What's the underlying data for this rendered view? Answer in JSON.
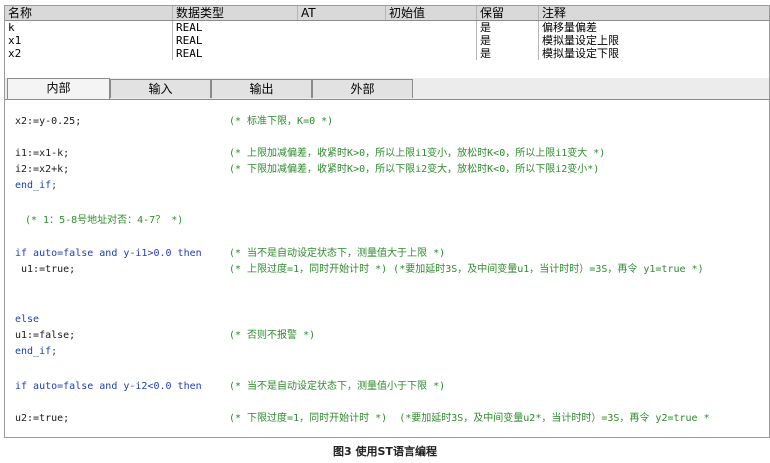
{
  "table": {
    "headers": [
      "名称",
      "数据类型",
      "AT",
      "初始值",
      "保留",
      "注释"
    ],
    "rows": [
      {
        "name": "k",
        "type": "REAL",
        "at": "",
        "init": "",
        "retain": "是",
        "comment": "偏移量偏差"
      },
      {
        "name": "x1",
        "type": "REAL",
        "at": "",
        "init": "",
        "retain": "是",
        "comment": "模拟量设定上限"
      },
      {
        "name": "x2",
        "type": "REAL",
        "at": "",
        "init": "",
        "retain": "是",
        "comment": "模拟量设定下限"
      }
    ]
  },
  "tabs": [
    "内部",
    "输入",
    "输出",
    "外部"
  ],
  "code_lines": [
    {
      "code": "x2:=y-0.25;",
      "comment": "(* 标准下限，K=0 *)"
    },
    {
      "code": "i1:=x1-k;",
      "comment": "(* 上限加减偏差，收紧时K>0，所以上限i1变小，放松时K<0，所以上限i1变大 *)"
    },
    {
      "code": "i2:=x2+k;",
      "comment": "(* 下限加减偏差，收紧时K>0，所以下限i2变大，放松时K<0，所以下限i2变小*)"
    },
    {
      "code": "end_if;",
      "comment": ""
    },
    {
      "code": "",
      "comment": "(* 1：5-8号地址对否：4-7？ *)"
    },
    {
      "code": "if auto=false and y-i1>0.0 then",
      "comment": "(* 当不是自动设定状态下，测量值大于上限 *)"
    },
    {
      "code": " u1:=true;",
      "comment": "(* 上限过度=1，同时开始计时 *) (*要加延时3S，及中间变量u1，当计时时）=3S，再令 y1=true *)"
    },
    {
      "code": "else",
      "comment": ""
    },
    {
      "code": "u1:=false;",
      "comment": "(* 否则不报警 *)"
    },
    {
      "code": "end_if;",
      "comment": ""
    },
    {
      "code": "if auto=false and y-i2<0.0 then",
      "comment": "(* 当不是自动设定状态下，测量值小于下限 *)"
    },
    {
      "code": "u2:=true;",
      "comment": "(* 下限过度=1，同时开始计时 *)  (*要加延时3S，及中间变量u2*，当计时时）=3S，再令 y2=true *"
    }
  ],
  "caption": "图3  使用ST语言编程",
  "colors": {
    "keyword": "#1f3fb0",
    "comment": "#2e8b2e",
    "header_bg": "#d9d9d9"
  }
}
